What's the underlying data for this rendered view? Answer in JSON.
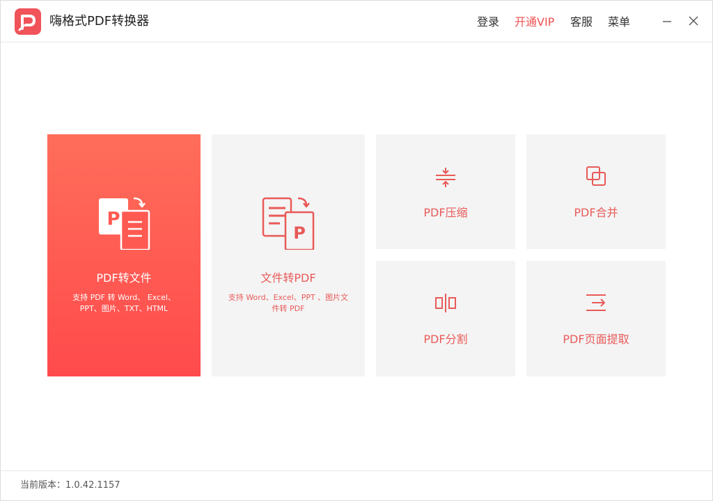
{
  "app": {
    "title": "嗨格式PDF转换器",
    "logo_icon": "pdf-logo-icon",
    "accent_color": "#ef5050"
  },
  "header": {
    "nav": [
      {
        "label": "登录"
      },
      {
        "label": "开通VIP"
      },
      {
        "label": "客服"
      },
      {
        "label": "菜单"
      }
    ],
    "minimize_icon": "minimize-icon",
    "close_icon": "close-icon"
  },
  "cards": {
    "pdf_to_file": {
      "title": "PDF转文件",
      "desc_line1": "支持 PDF 转 Word、 Excel、",
      "desc_line2": "PPT、图片、TXT、HTML",
      "icon": "pdf-to-file-icon"
    },
    "file_to_pdf": {
      "title": "文件转PDF",
      "desc_line1": "支持 Word、Excel、PPT 、图片文",
      "desc_line2": "件转 PDF",
      "icon": "file-to-pdf-icon"
    },
    "compress": {
      "title": "PDF压缩",
      "icon": "compress-icon"
    },
    "merge": {
      "title": "PDF合并",
      "icon": "merge-icon"
    },
    "split": {
      "title": "PDF分割",
      "icon": "split-icon"
    },
    "extract": {
      "title": "PDF页面提取",
      "icon": "extract-icon"
    }
  },
  "footer": {
    "version_text": "当前版本：1.0.42.1157"
  }
}
